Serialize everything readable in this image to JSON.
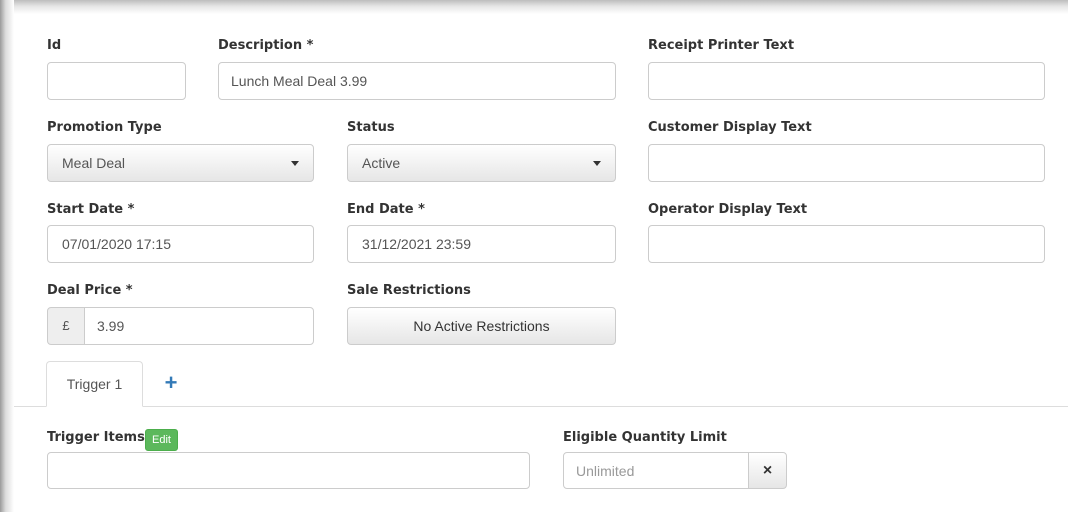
{
  "form": {
    "id": {
      "label": "Id",
      "value": ""
    },
    "description": {
      "label": "Description *",
      "value": "Lunch Meal Deal 3.99"
    },
    "receipt_printer_text": {
      "label": "Receipt Printer Text",
      "value": ""
    },
    "promotion_type": {
      "label": "Promotion Type",
      "value": "Meal Deal"
    },
    "status": {
      "label": "Status",
      "value": "Active"
    },
    "customer_display_text": {
      "label": "Customer Display Text",
      "value": ""
    },
    "start_date": {
      "label": "Start Date *",
      "value": "07/01/2020 17:15"
    },
    "end_date": {
      "label": "End Date *",
      "value": "31/12/2021 23:59"
    },
    "operator_display_text": {
      "label": "Operator Display Text",
      "value": ""
    },
    "deal_price": {
      "label": "Deal Price *",
      "currency": "£",
      "value": "3.99"
    },
    "sale_restrictions": {
      "label": "Sale Restrictions",
      "button": "No Active Restrictions"
    }
  },
  "tabs": {
    "items": [
      {
        "label": "Trigger 1"
      }
    ],
    "add_icon": "plus-icon",
    "add_glyph": "+"
  },
  "trigger": {
    "items_label": "Trigger Items",
    "edit_label": "Edit",
    "items_value": "",
    "quantity_label": "Eligible Quantity Limit",
    "quantity_placeholder": "Unlimited",
    "clear_glyph": "×",
    "clear_icon": "close-icon"
  },
  "colors": {
    "accent": "#337ab7",
    "edit_badge": "#5cb85c"
  }
}
